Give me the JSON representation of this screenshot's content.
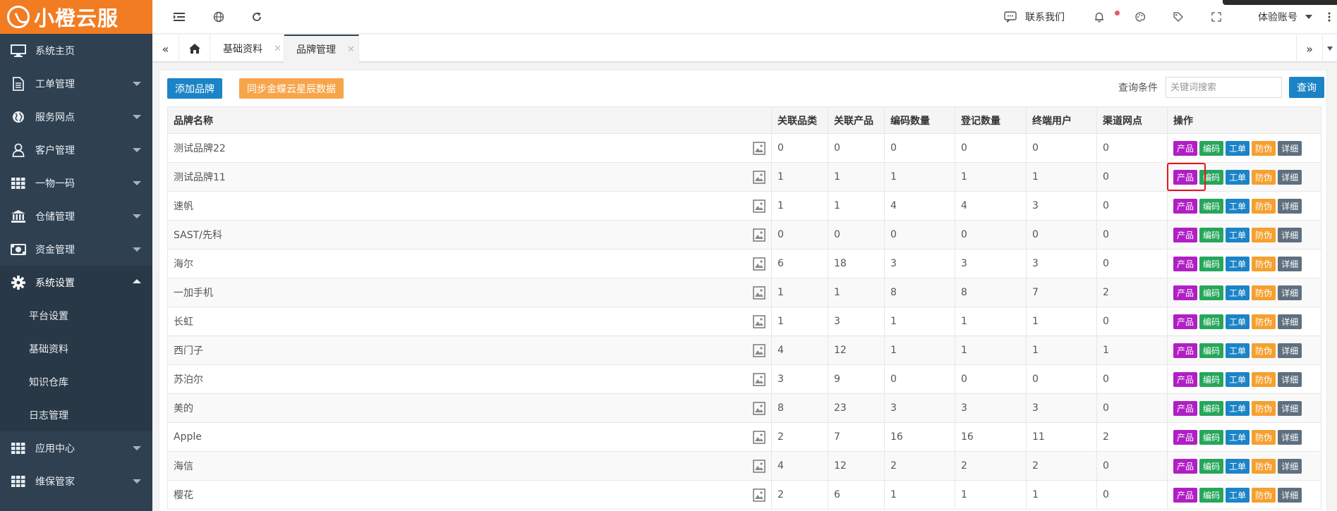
{
  "brand": {
    "logo_text": "小橙云服",
    "color": "#f27c22"
  },
  "sidebar": {
    "items": [
      {
        "label": "系统主页",
        "icon": "monitor-icon",
        "has_arrow": false
      },
      {
        "label": "工单管理",
        "icon": "document-icon",
        "has_arrow": true
      },
      {
        "label": "服务网点",
        "icon": "globe-icon",
        "has_arrow": true
      },
      {
        "label": "客户管理",
        "icon": "user-icon",
        "has_arrow": true
      },
      {
        "label": "一物一码",
        "icon": "grid-icon",
        "has_arrow": true
      },
      {
        "label": "仓储管理",
        "icon": "bank-icon",
        "has_arrow": true
      },
      {
        "label": "资金管理",
        "icon": "money-icon",
        "has_arrow": true
      },
      {
        "label": "系统设置",
        "icon": "gear-icon",
        "has_arrow": true,
        "expanded": true
      }
    ],
    "submenu": [
      "平台设置",
      "基础资料",
      "知识仓库",
      "日志管理"
    ],
    "items_after": [
      {
        "label": "应用中心",
        "icon": "grid-icon",
        "has_arrow": true
      },
      {
        "label": "维保管家",
        "icon": "grid-icon",
        "has_arrow": true
      }
    ]
  },
  "topbar": {
    "contact": "联系我们",
    "account": "体验账号"
  },
  "tabs": [
    {
      "label": "基础资料"
    },
    {
      "label": "品牌管理",
      "active": true
    }
  ],
  "toolbar": {
    "add_brand": "添加品牌",
    "sync": "同步金蝶云星辰数据",
    "search_label": "查询条件",
    "search_placeholder": "关键词搜索",
    "search_button": "查询"
  },
  "table": {
    "headers": [
      "品牌名称",
      "关联品类",
      "关联产品",
      "编码数量",
      "登记数量",
      "终端用户",
      "渠道网点",
      "操作"
    ],
    "rows": [
      [
        "测试品牌22",
        "0",
        "0",
        "0",
        "0",
        "0",
        "0"
      ],
      [
        "测试品牌11",
        "1",
        "1",
        "1",
        "1",
        "1",
        "0"
      ],
      [
        "速帆",
        "1",
        "1",
        "4",
        "4",
        "3",
        "0"
      ],
      [
        "SAST/先科",
        "0",
        "0",
        "0",
        "0",
        "0",
        "0"
      ],
      [
        "海尔",
        "6",
        "18",
        "3",
        "3",
        "3",
        "0"
      ],
      [
        "一加手机",
        "1",
        "1",
        "8",
        "8",
        "7",
        "2"
      ],
      [
        "长虹",
        "1",
        "3",
        "1",
        "1",
        "1",
        "0"
      ],
      [
        "西门子",
        "4",
        "12",
        "1",
        "1",
        "1",
        "1"
      ],
      [
        "苏泊尔",
        "3",
        "9",
        "0",
        "0",
        "0",
        "0"
      ],
      [
        "美的",
        "8",
        "23",
        "3",
        "3",
        "3",
        "0"
      ],
      [
        "Apple",
        "2",
        "7",
        "16",
        "16",
        "11",
        "2"
      ],
      [
        "海信",
        "4",
        "12",
        "2",
        "2",
        "2",
        "0"
      ],
      [
        "樱花",
        "2",
        "6",
        "1",
        "1",
        "1",
        "0"
      ]
    ],
    "actions": [
      "产品",
      "编码",
      "工单",
      "防伪",
      "详细"
    ]
  }
}
